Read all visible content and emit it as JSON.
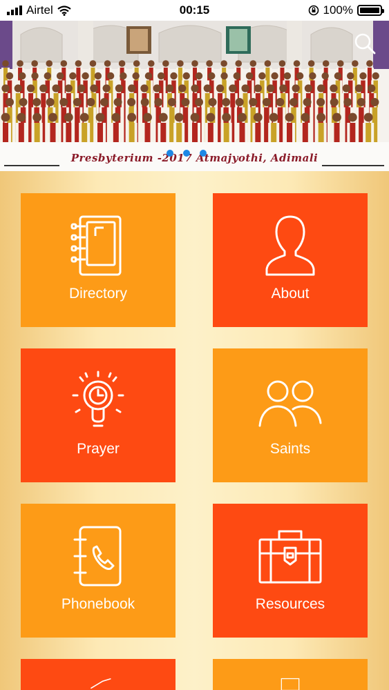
{
  "status_bar": {
    "carrier": "Airtel",
    "time": "00:15",
    "battery": "100%",
    "battery_level": 1.0
  },
  "banner": {
    "caption": "Presbyterium -2017  Atmajyothi, Adimali",
    "carousel_total": 3,
    "carousel_active": 0
  },
  "menu": {
    "directory": "Directory",
    "about": "About",
    "prayer": "Prayer",
    "saints": "Saints",
    "phonebook": "Phonebook",
    "resources": "Resources"
  },
  "colors": {
    "tile_yellow": "#fd9b17",
    "tile_red": "#fe4a12",
    "carousel_dot": "#1e88e5"
  },
  "icons": {
    "search": "search-icon",
    "directory": "notebook-icon",
    "about": "person-icon",
    "prayer": "lightbulb-clock-icon",
    "saints": "people-icon",
    "phonebook": "phonebook-icon",
    "resources": "briefcase-icon"
  }
}
